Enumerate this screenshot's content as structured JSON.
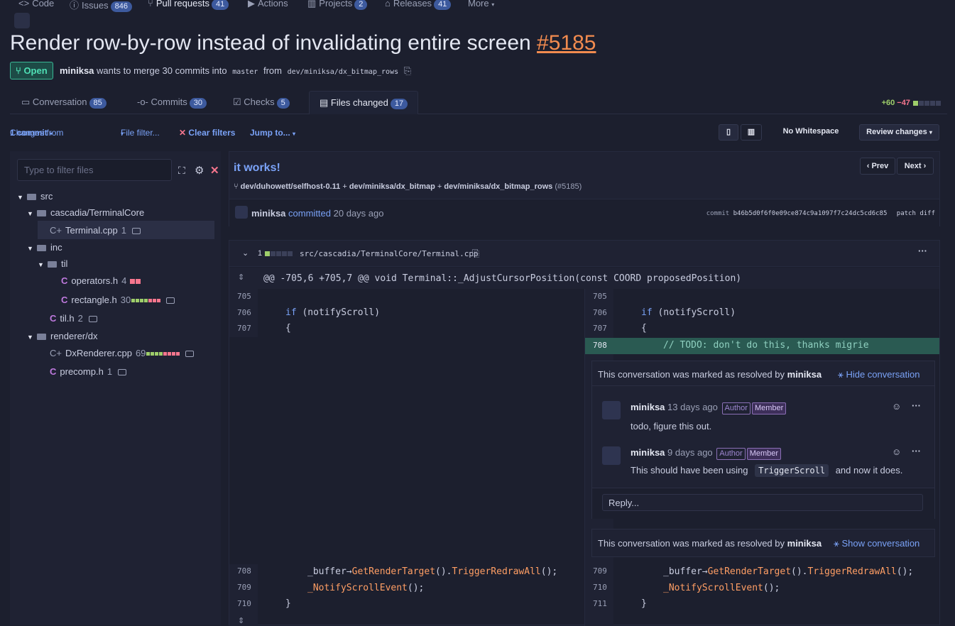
{
  "nav": {
    "code": "Code",
    "issues": "Issues",
    "issues_count": "846",
    "pulls": "Pull requests",
    "pulls_count": "41",
    "actions": "Actions",
    "projects": "Projects",
    "projects_count": "2",
    "releases": "Releases",
    "releases_count": "41",
    "more": "More"
  },
  "pr": {
    "title": "Render row-by-row instead of invalidating entire screen",
    "number": "#5185",
    "state": "Open",
    "author": "miniksa",
    "merge_text": "wants to merge 30 commits into",
    "base": "master",
    "from_word": "from",
    "head": "dev/miniksa/dx_bitmap_rows"
  },
  "tabs": {
    "conversation": "Conversation",
    "conversation_count": "85",
    "commits": "Commits",
    "commits_count": "30",
    "checks": "Checks",
    "checks_count": "5",
    "files": "Files changed",
    "files_count": "17"
  },
  "diffstat": {
    "additions": "+60",
    "deletions": "−47"
  },
  "toolbar": {
    "changes_from": "Changes from",
    "one_commit": "1 commit",
    "file_filter": "File filter...",
    "clear_filters": "Clear filters",
    "jump_to": "Jump to...",
    "no_whitespace": "No Whitespace",
    "review_changes": "Review changes"
  },
  "sidebar": {
    "filter_placeholder": "Type to filter files",
    "src": "src",
    "cascadia": "cascadia/TerminalCore",
    "terminal_cpp": "Terminal.cpp",
    "terminal_cpp_count": "1",
    "inc": "inc",
    "til": "til",
    "operators_h": "operators.h",
    "operators_h_count": "4",
    "rectangle_h": "rectangle.h",
    "rectangle_h_count": "30",
    "til_h": "til.h",
    "til_h_count": "2",
    "renderer_dx": "renderer/dx",
    "dxrenderer_cpp": "DxRenderer.cpp",
    "dxrenderer_cpp_count": "69",
    "precomp_h": "precomp.h",
    "precomp_h_count": "1"
  },
  "commit": {
    "message": "it works!",
    "prev": "Prev",
    "next": "Next",
    "branch1": "dev/duhowett/selfhost-0.11",
    "branch2": "dev/miniksa/dx_bitmap",
    "branch3": "dev/miniksa/dx_bitmap_rows",
    "pr_ref": "(#5185)",
    "author": "miniksa",
    "committed": "committed",
    "when": "20 days ago",
    "commit_label": "commit",
    "sha": "b46b5d0f6f0e09ce874c9a1097f7c24dc5cd6c85",
    "patch": "patch",
    "diff": "diff"
  },
  "file": {
    "change_count": "1",
    "path": "src/cascadia/TerminalCore/Terminal.cpp",
    "hunk": "@@ -705,6 +705,7 @@ void Terminal::_AdjustCursorPosition(const COORD proposedPosition)"
  },
  "left": {
    "l705": "705",
    "l706": "706",
    "l707": "707",
    "l708": "708",
    "l709": "709",
    "l710": "710",
    "c706_kw": "if",
    "c706_rest": " (notifyScroll)",
    "c707": "{",
    "c708_a": "_buffer",
    "c708_b": "GetRenderTarget",
    "c708_c": "().",
    "c708_d": "TriggerRedrawAll",
    "c708_e": "();",
    "c709_fn": "_NotifyScrollEvent",
    "c709_rest": "();",
    "c710": "}"
  },
  "right": {
    "l705": "705",
    "l706": "706",
    "l707": "707",
    "l708": "708",
    "l709": "709",
    "l710": "710",
    "l711": "711",
    "added_line": "// TODO: don't do this, thanks migrie"
  },
  "conversation": {
    "resolved_text": "This conversation was marked as resolved by",
    "resolver": "miniksa",
    "hide": "Hide conversation",
    "show": "Show conversation",
    "c1_author": "miniksa",
    "c1_time": "13 days ago",
    "c1_body": "todo, figure this out.",
    "c2_author": "miniksa",
    "c2_time": "9 days ago",
    "c2_body_a": "This should have been using",
    "c2_code": "TriggerScroll",
    "c2_body_b": "and now it does.",
    "role_author": "Author",
    "role_member": "Member",
    "reply_placeholder": "Reply..."
  }
}
